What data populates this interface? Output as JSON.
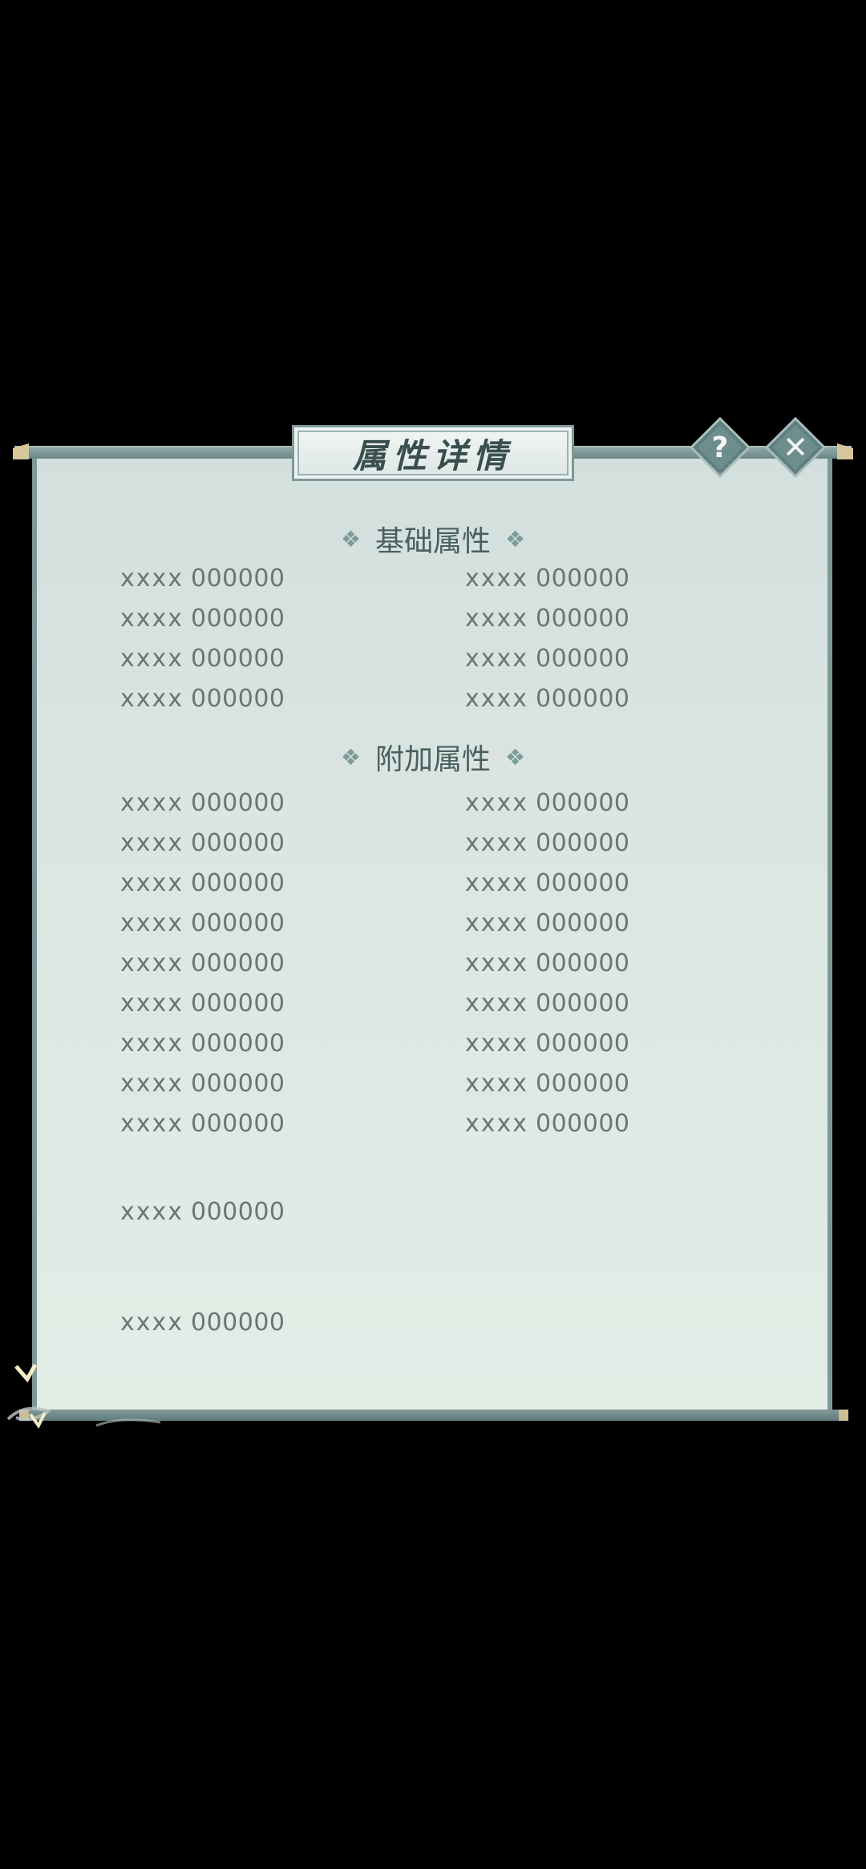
{
  "title": "属性详情",
  "buttons": {
    "help_glyph": "?",
    "close_glyph": "✕"
  },
  "sections": {
    "basic": {
      "heading": "基础属性",
      "ornament": "❖",
      "rows": [
        {
          "left": {
            "name": "xxxx",
            "value": "000000"
          },
          "right": {
            "name": "xxxx",
            "value": "000000"
          }
        },
        {
          "left": {
            "name": "xxxx",
            "value": "000000"
          },
          "right": {
            "name": "xxxx",
            "value": "000000"
          }
        },
        {
          "left": {
            "name": "xxxx",
            "value": "000000"
          },
          "right": {
            "name": "xxxx",
            "value": "000000"
          }
        },
        {
          "left": {
            "name": "xxxx",
            "value": "000000"
          },
          "right": {
            "name": "xxxx",
            "value": "000000"
          }
        }
      ]
    },
    "extra": {
      "heading": "附加属性",
      "ornament": "❖",
      "rows": [
        {
          "left": {
            "name": "xxxx",
            "value": "000000"
          },
          "right": {
            "name": "xxxx",
            "value": "000000"
          }
        },
        {
          "left": {
            "name": "xxxx",
            "value": "000000"
          },
          "right": {
            "name": "xxxx",
            "value": "000000"
          }
        },
        {
          "left": {
            "name": "xxxx",
            "value": "000000"
          },
          "right": {
            "name": "xxxx",
            "value": "000000"
          }
        },
        {
          "left": {
            "name": "xxxx",
            "value": "000000"
          },
          "right": {
            "name": "xxxx",
            "value": "000000"
          }
        },
        {
          "left": {
            "name": "xxxx",
            "value": "000000"
          },
          "right": {
            "name": "xxxx",
            "value": "000000"
          }
        },
        {
          "left": {
            "name": "xxxx",
            "value": "000000"
          },
          "right": {
            "name": "xxxx",
            "value": "000000"
          }
        },
        {
          "left": {
            "name": "xxxx",
            "value": "000000"
          },
          "right": {
            "name": "xxxx",
            "value": "000000"
          }
        },
        {
          "left": {
            "name": "xxxx",
            "value": "000000"
          },
          "right": {
            "name": "xxxx",
            "value": "000000"
          }
        },
        {
          "left": {
            "name": "xxxx",
            "value": "000000"
          },
          "right": {
            "name": "xxxx",
            "value": "000000"
          }
        }
      ]
    },
    "misc": [
      {
        "name": "xxxx",
        "value": "000000"
      },
      {
        "name": "xxxx",
        "value": "000000"
      }
    ]
  }
}
